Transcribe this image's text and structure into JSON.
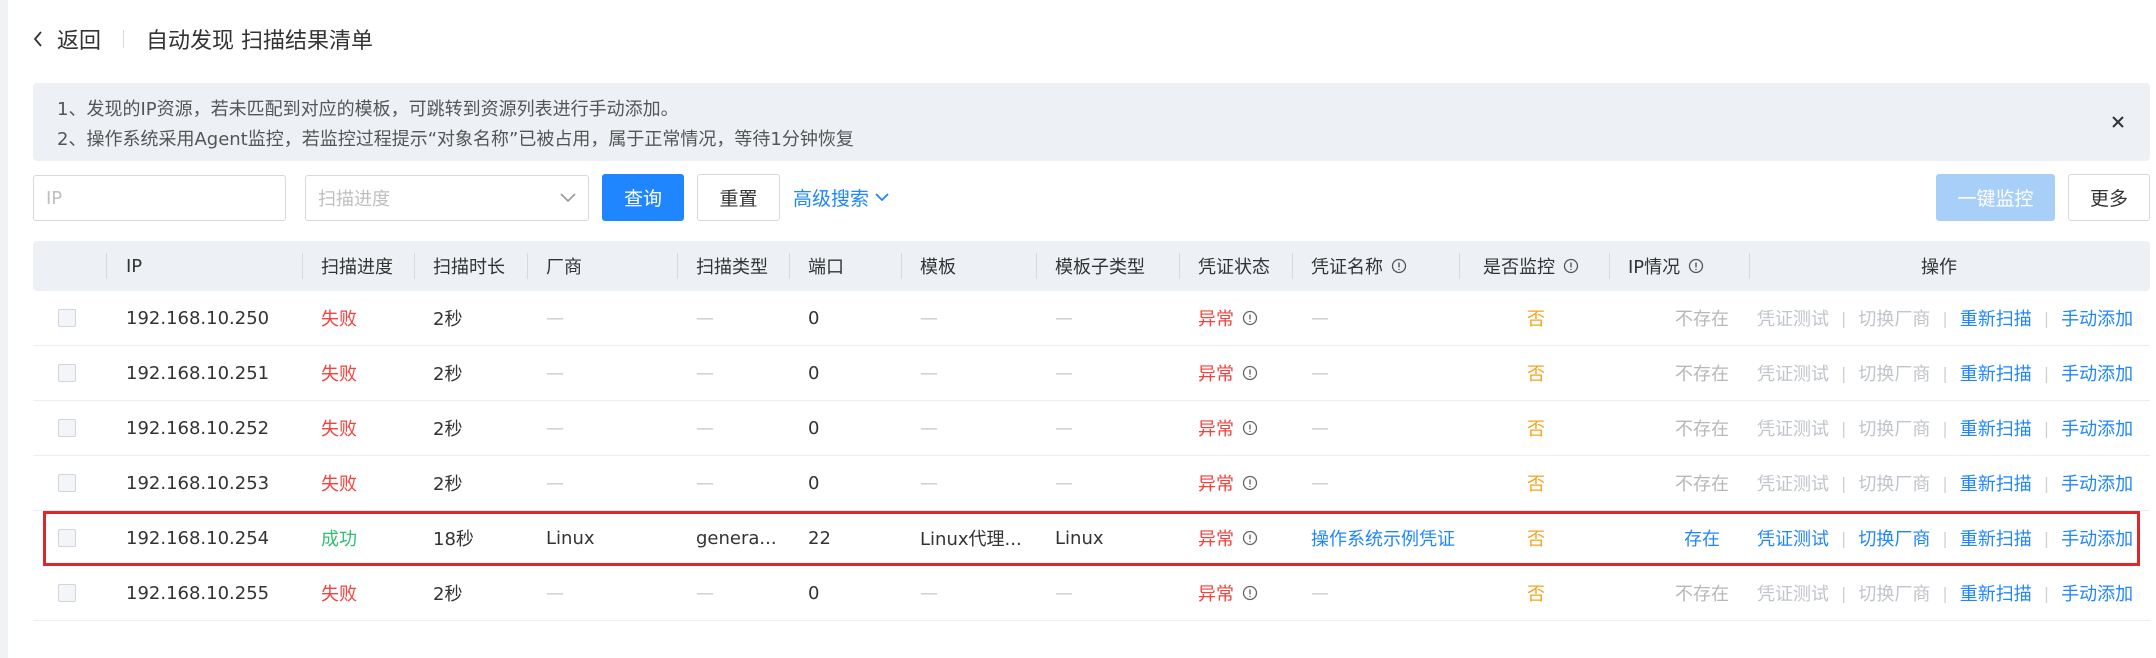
{
  "header": {
    "back_label": "返回",
    "title": "自动发现 扫描结果清单"
  },
  "notice": {
    "lines": [
      "1、发现的IP资源，若未匹配到对应的模板，可跳转到资源列表进行手动添加。",
      "2、操作系统采用Agent监控，若监控过程提示“对象名称”已被占用，属于正常情况，等待1分钟恢复"
    ]
  },
  "toolbar": {
    "ip_placeholder": "IP",
    "progress_placeholder": "扫描进度",
    "query_label": "查询",
    "reset_label": "重置",
    "advanced_label": "高级搜索",
    "monitor_label": "一键监控",
    "more_label": "更多"
  },
  "table": {
    "columns": [
      "IP",
      "扫描进度",
      "扫描时长",
      "厂商",
      "扫描类型",
      "端口",
      "模板",
      "模板子类型",
      "凭证状态",
      "凭证名称",
      "是否监控",
      "IP情况",
      "操作"
    ],
    "actions": [
      "凭证测试",
      "切换厂商",
      "重新扫描",
      "手动添加"
    ],
    "rows": [
      {
        "ip": "192.168.10.250",
        "progress": "失败",
        "duration": "2秒",
        "vendor": "—",
        "scan_type": "—",
        "port": "0",
        "template": "—",
        "subtype": "—",
        "cred_status": "异常",
        "cred_name": "—",
        "monitored": "否",
        "ip_status": "不存在",
        "status": "fail",
        "highlight": false
      },
      {
        "ip": "192.168.10.251",
        "progress": "失败",
        "duration": "2秒",
        "vendor": "—",
        "scan_type": "—",
        "port": "0",
        "template": "—",
        "subtype": "—",
        "cred_status": "异常",
        "cred_name": "—",
        "monitored": "否",
        "ip_status": "不存在",
        "status": "fail",
        "highlight": false
      },
      {
        "ip": "192.168.10.252",
        "progress": "失败",
        "duration": "2秒",
        "vendor": "—",
        "scan_type": "—",
        "port": "0",
        "template": "—",
        "subtype": "—",
        "cred_status": "异常",
        "cred_name": "—",
        "monitored": "否",
        "ip_status": "不存在",
        "status": "fail",
        "highlight": false
      },
      {
        "ip": "192.168.10.253",
        "progress": "失败",
        "duration": "2秒",
        "vendor": "—",
        "scan_type": "—",
        "port": "0",
        "template": "—",
        "subtype": "—",
        "cred_status": "异常",
        "cred_name": "—",
        "monitored": "否",
        "ip_status": "不存在",
        "status": "fail",
        "highlight": false
      },
      {
        "ip": "192.168.10.254",
        "progress": "成功",
        "duration": "18秒",
        "vendor": "Linux",
        "scan_type": "genera...",
        "port": "22",
        "template": "Linux代理...",
        "subtype": "Linux",
        "cred_status": "异常",
        "cred_name": "操作系统示例凭证",
        "monitored": "否",
        "ip_status": "存在",
        "status": "success",
        "highlight": true
      },
      {
        "ip": "192.168.10.255",
        "progress": "失败",
        "duration": "2秒",
        "vendor": "—",
        "scan_type": "—",
        "port": "0",
        "template": "—",
        "subtype": "—",
        "cred_status": "异常",
        "cred_name": "—",
        "monitored": "否",
        "ip_status": "不存在",
        "status": "fail",
        "highlight": false
      }
    ]
  },
  "colors": {
    "primary": "#1f86ff",
    "fail": "#f5413b",
    "success": "#2fbf70",
    "warning": "#f5a31d",
    "highlight_border": "#e0262b"
  },
  "icons": [
    "chevron-left-icon",
    "close-icon",
    "chevron-down-icon",
    "info-icon"
  ]
}
